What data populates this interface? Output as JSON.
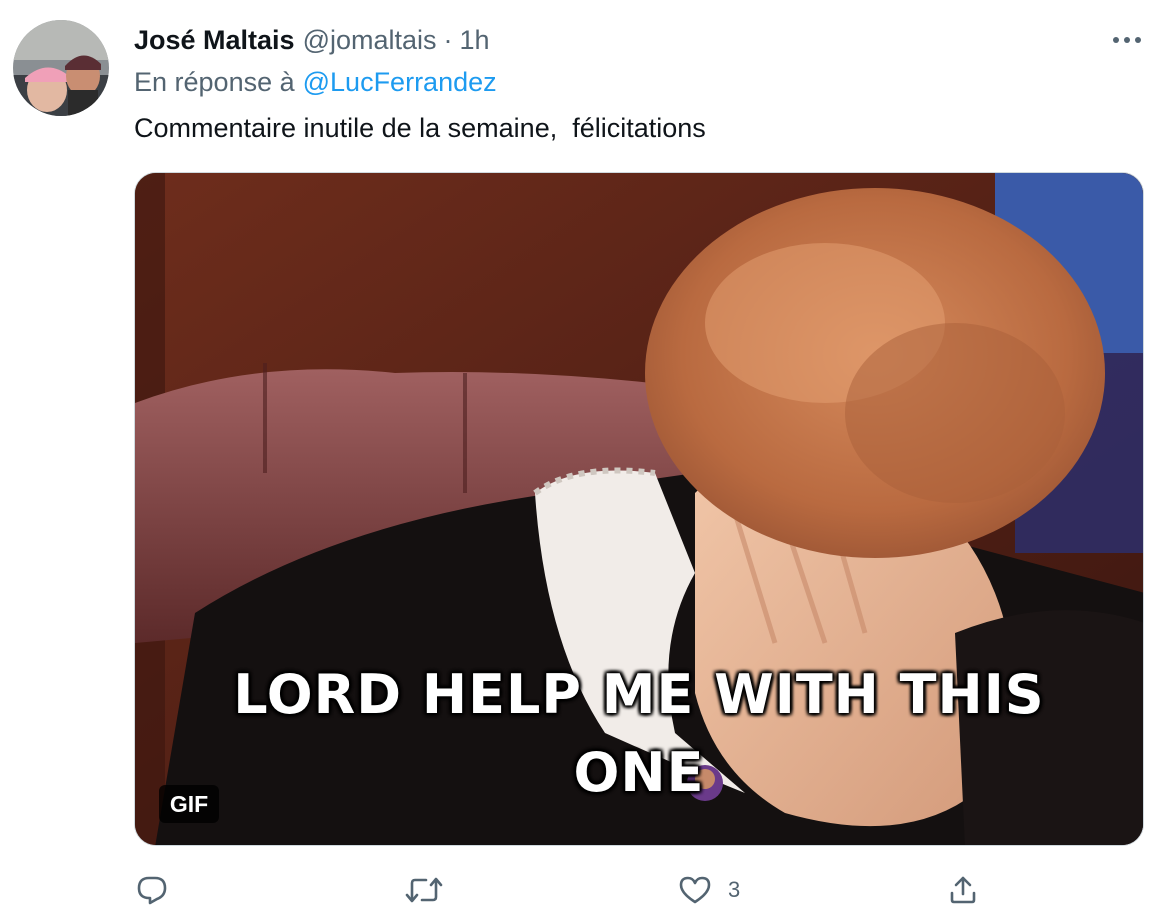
{
  "tweet": {
    "author": {
      "display_name": "José Maltais",
      "handle": "@jomaltais",
      "separator": "·",
      "time": "1h"
    },
    "reply": {
      "prefix": "En réponse à",
      "mention": "@LucFerrandez"
    },
    "text": "Commentaire inutile de la semaine,  félicitations",
    "media": {
      "caption_line1": "LORD HELP ME WITH THIS",
      "caption_line2": "ONE",
      "badge": "GIF"
    },
    "actions": {
      "reply_icon": "reply-icon",
      "retweet_icon": "retweet-icon",
      "like_icon": "heart-icon",
      "like_count": "3",
      "share_icon": "share-icon",
      "more_icon": "more-options-icon"
    }
  },
  "colors": {
    "text_primary": "#0f1419",
    "text_secondary": "#536471",
    "link": "#1d9bf0",
    "border": "#cfd9de"
  }
}
